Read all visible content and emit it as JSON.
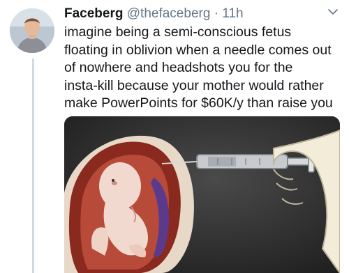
{
  "author": {
    "display_name": "Faceberg",
    "handle": "@thefaceberg",
    "separator": "·",
    "time": "11h"
  },
  "tweet": {
    "lines": [
      "imagine being a semi-conscious fetus",
      "floating in oblivion when a needle comes out",
      "of nowhere and headshots you for the",
      "insta-kill because your mother would rather",
      "make PowerPoints for $60K/y than raise you"
    ]
  },
  "icons": {
    "avatar": "profile-photo",
    "caret": "chevron-down-icon",
    "thread": "thread-line"
  },
  "colors": {
    "text": "#14171a",
    "secondary": "#657786",
    "thread": "#cfd9de",
    "media_bg": "#2f2f2f",
    "womb": "#8a2a1e",
    "placenta": "#5b3a8c"
  }
}
